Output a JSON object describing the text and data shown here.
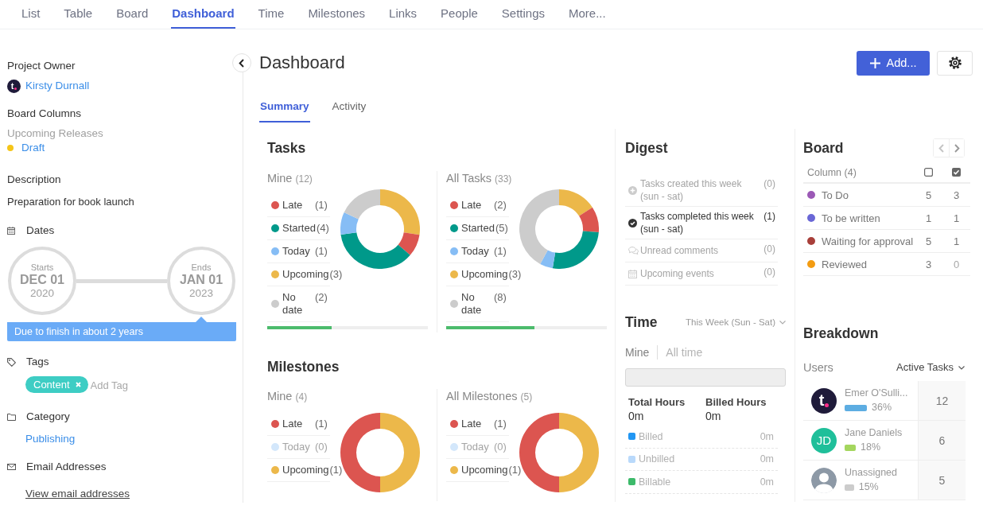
{
  "nav_tabs": [
    {
      "label": "List",
      "selected": false
    },
    {
      "label": "Table",
      "selected": false
    },
    {
      "label": "Board",
      "selected": false
    },
    {
      "label": "Dashboard",
      "selected": true
    },
    {
      "label": "Time",
      "selected": false
    },
    {
      "label": "Milestones",
      "selected": false
    },
    {
      "label": "Links",
      "selected": false
    },
    {
      "label": "People",
      "selected": false
    },
    {
      "label": "Settings",
      "selected": false
    },
    {
      "label": "More...",
      "selected": false
    }
  ],
  "sidebar": {
    "project_owner": {
      "label": "Project Owner",
      "avatar": {
        "kind": "logo",
        "text": "t"
      },
      "name": "Kirsty Durnall"
    },
    "board_columns": {
      "label": "Board Columns",
      "board": "Upcoming Releases",
      "column": "Draft",
      "color": "#f5c518"
    },
    "description": {
      "label": "Description",
      "text": "Preparation for book launch"
    },
    "dates": {
      "label": "Dates",
      "start": {
        "caption": "Starts",
        "day": "DEC 01",
        "year": "2020"
      },
      "end": {
        "caption": "Ends",
        "day": "JAN 01",
        "year": "2023"
      },
      "note": "Due to finish in about 2 years"
    },
    "tags": {
      "label": "Tags",
      "items": [
        "Content"
      ],
      "placeholder": "Add Tag"
    },
    "category": {
      "label": "Category",
      "value": "Publishing"
    },
    "email": {
      "label": "Email Addresses",
      "link": "View email addresses"
    }
  },
  "header": {
    "title": "Dashboard",
    "add_button": "Add..."
  },
  "tabs": [
    {
      "label": "Summary",
      "selected": true
    },
    {
      "label": "Activity",
      "selected": false
    }
  ],
  "tasks": {
    "title": "Tasks",
    "groups": [
      {
        "label": "Mine",
        "count": "(12)",
        "legend": [
          {
            "label": "Late",
            "count": "(1)",
            "color": "#dc5550",
            "disabled": false
          },
          {
            "label": "Started",
            "count": "(4)",
            "color": "#00998a",
            "disabled": false
          },
          {
            "label": "Today",
            "count": "(1)",
            "color": "#86bdf5",
            "disabled": false
          },
          {
            "label": "Upcoming",
            "count": "(3)",
            "color": "#ecb84a",
            "disabled": false
          },
          {
            "label": "No date",
            "count": "(2)",
            "color": "#cccccc",
            "disabled": false
          }
        ],
        "chart_data": {
          "type": "donut",
          "values": [
            27.3,
            9.1,
            36.4,
            9.1,
            18.1
          ],
          "colors": [
            "#ecb84a",
            "#dc5550",
            "#00998a",
            "#86bdf5",
            "#cccccc"
          ]
        },
        "level": 0.4
      },
      {
        "label": "All Tasks",
        "count": "(33)",
        "legend": [
          {
            "label": "Late",
            "count": "(2)",
            "color": "#dc5550",
            "disabled": false
          },
          {
            "label": "Started",
            "count": "(5)",
            "color": "#00998a",
            "disabled": false
          },
          {
            "label": "Today",
            "count": "(1)",
            "color": "#86bdf5",
            "disabled": false
          },
          {
            "label": "Upcoming",
            "count": "(3)",
            "color": "#ecb84a",
            "disabled": false
          },
          {
            "label": "No date",
            "count": "(8)",
            "color": "#cccccc",
            "disabled": false
          }
        ],
        "chart_data": {
          "type": "donut",
          "values": [
            15.8,
            10.5,
            26.3,
            5.3,
            42.1
          ],
          "colors": [
            "#ecb84a",
            "#dc5550",
            "#00998a",
            "#86bdf5",
            "#cccccc"
          ]
        },
        "level": 0.55
      }
    ]
  },
  "milestones": {
    "title": "Milestones",
    "groups": [
      {
        "label": "Mine",
        "count": "(4)",
        "legend": [
          {
            "label": "Late",
            "count": "(1)",
            "color": "#dc5550",
            "disabled": false
          },
          {
            "label": "Today",
            "count": "(0)",
            "color": "#d3e7fb",
            "disabled": true
          },
          {
            "label": "Upcoming",
            "count": "(1)",
            "color": "#ecb84a",
            "disabled": false
          }
        ],
        "chart_data": {
          "type": "donut",
          "values": [
            50,
            50
          ],
          "colors": [
            "#ecb84a",
            "#dc5550"
          ]
        }
      },
      {
        "label": "All Milestones",
        "count": "(5)",
        "legend": [
          {
            "label": "Late",
            "count": "(1)",
            "color": "#dc5550",
            "disabled": false
          },
          {
            "label": "Today",
            "count": "(0)",
            "color": "#d3e7fb",
            "disabled": true
          },
          {
            "label": "Upcoming",
            "count": "(1)",
            "color": "#ecb84a",
            "disabled": false
          }
        ],
        "chart_data": {
          "type": "donut",
          "values": [
            50,
            50
          ],
          "colors": [
            "#ecb84a",
            "#dc5550"
          ]
        }
      }
    ]
  },
  "digest": {
    "title": "Digest",
    "items": [
      {
        "kind": "created",
        "label": "Tasks created this week",
        "period": "(sun - sat)",
        "count": "(0)",
        "disabled": true
      },
      {
        "kind": "completed",
        "label": "Tasks completed this week",
        "period": "(sun - sat)",
        "count": "(1)",
        "disabled": false
      },
      {
        "kind": "comments",
        "label": "Unread comments",
        "count": "(0)",
        "disabled": true
      },
      {
        "kind": "events",
        "label": "Upcoming events",
        "count": "(0)",
        "disabled": true
      }
    ]
  },
  "time": {
    "title": "Time",
    "range": "This Week (Sun - Sat)",
    "scopes": [
      {
        "label": "Mine",
        "selected": true
      },
      {
        "label": "All time",
        "selected": false
      }
    ],
    "totals": [
      {
        "label": "Total Hours",
        "value": "0m"
      },
      {
        "label": "Billed Hours",
        "value": "0m"
      }
    ],
    "legend": [
      {
        "label": "Billed",
        "value": "0m",
        "color": "#2196f3"
      },
      {
        "label": "Unbilled",
        "value": "0m",
        "color": "#b9d9fb"
      },
      {
        "label": "Billable",
        "value": "0m",
        "color": "#3cba6a"
      }
    ]
  },
  "board": {
    "title": "Board",
    "column_header": "Column (4)",
    "rows": [
      {
        "name": "To Do",
        "color": "#9b59b6",
        "counts": [
          {
            "value": "5",
            "dim": false
          },
          {
            "value": "3",
            "dim": false
          }
        ]
      },
      {
        "name": "To be written",
        "color": "#6a67d6",
        "counts": [
          {
            "value": "1",
            "dim": false
          },
          {
            "value": "1",
            "dim": false
          }
        ]
      },
      {
        "name": "Waiting for approval",
        "color": "#a83f3a",
        "counts": [
          {
            "value": "5",
            "dim": false
          },
          {
            "value": "1",
            "dim": false
          }
        ]
      },
      {
        "name": "Reviewed",
        "color": "#f39c12",
        "counts": [
          {
            "value": "3",
            "dim": false
          },
          {
            "value": "0",
            "dim": true
          }
        ]
      }
    ]
  },
  "breakdown": {
    "title": "Breakdown",
    "group_label": "Users",
    "sort": "Active Tasks",
    "users": [
      {
        "name": "Emer O'Sulli...",
        "avatar": {
          "kind": "logo",
          "text": "t"
        },
        "color": "#5dade2",
        "percent": "36%",
        "count": "12"
      },
      {
        "name": "Jane Daniels",
        "avatar": {
          "kind": "initials",
          "text": "JD",
          "color": "#1fbf9a"
        },
        "color": "#a4d65e",
        "percent": "18%",
        "count": "6"
      },
      {
        "name": "Unassigned",
        "avatar": {
          "kind": "silhouette"
        },
        "color": "#cccccc",
        "percent": "15%",
        "count": "5"
      }
    ]
  }
}
